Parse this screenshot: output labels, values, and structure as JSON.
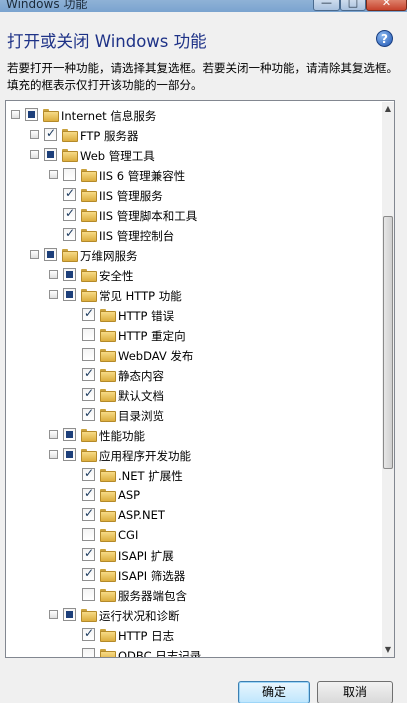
{
  "window": {
    "title": "Windows 功能",
    "min_glyph": "—",
    "max_glyph": "□",
    "close_glyph": "✕"
  },
  "heading": "打开或关闭 Windows 功能",
  "help_glyph": "?",
  "description": "若要打开一种功能，请选择其复选框。若要关闭一种功能，请清除其复选框。填充的框表示仅打开该功能的一部分。",
  "tree": [
    {
      "label": "Internet 信息服务",
      "level": 0,
      "expander": "⊟",
      "state": "partial"
    },
    {
      "label": "FTP 服务器",
      "level": 1,
      "expander": "⊞",
      "state": "checked"
    },
    {
      "label": "Web 管理工具",
      "level": 1,
      "expander": "⊟",
      "state": "partial"
    },
    {
      "label": "IIS 6 管理兼容性",
      "level": 2,
      "expander": "⊞",
      "state": "unchecked"
    },
    {
      "label": "IIS 管理服务",
      "level": 2,
      "expander": "",
      "state": "checked"
    },
    {
      "label": "IIS 管理脚本和工具",
      "level": 2,
      "expander": "",
      "state": "checked"
    },
    {
      "label": "IIS 管理控制台",
      "level": 2,
      "expander": "",
      "state": "checked"
    },
    {
      "label": "万维网服务",
      "level": 1,
      "expander": "⊟",
      "state": "partial"
    },
    {
      "label": "安全性",
      "level": 2,
      "expander": "⊞",
      "state": "partial"
    },
    {
      "label": "常见 HTTP 功能",
      "level": 2,
      "expander": "⊟",
      "state": "partial"
    },
    {
      "label": "HTTP 错误",
      "level": 3,
      "expander": "",
      "state": "checked"
    },
    {
      "label": "HTTP 重定向",
      "level": 3,
      "expander": "",
      "state": "unchecked"
    },
    {
      "label": "WebDAV 发布",
      "level": 3,
      "expander": "",
      "state": "unchecked"
    },
    {
      "label": "静态内容",
      "level": 3,
      "expander": "",
      "state": "checked"
    },
    {
      "label": "默认文档",
      "level": 3,
      "expander": "",
      "state": "checked"
    },
    {
      "label": "目录浏览",
      "level": 3,
      "expander": "",
      "state": "checked"
    },
    {
      "label": "性能功能",
      "level": 2,
      "expander": "⊞",
      "state": "partial"
    },
    {
      "label": "应用程序开发功能",
      "level": 2,
      "expander": "⊟",
      "state": "partial"
    },
    {
      "label": ".NET 扩展性",
      "level": 3,
      "expander": "",
      "state": "checked"
    },
    {
      "label": "ASP",
      "level": 3,
      "expander": "",
      "state": "checked"
    },
    {
      "label": "ASP.NET",
      "level": 3,
      "expander": "",
      "state": "checked"
    },
    {
      "label": "CGI",
      "level": 3,
      "expander": "",
      "state": "unchecked"
    },
    {
      "label": "ISAPI 扩展",
      "level": 3,
      "expander": "",
      "state": "checked"
    },
    {
      "label": "ISAPI 筛选器",
      "level": 3,
      "expander": "",
      "state": "checked"
    },
    {
      "label": "服务器端包含",
      "level": 3,
      "expander": "",
      "state": "unchecked"
    },
    {
      "label": "运行状况和诊断",
      "level": 2,
      "expander": "⊟",
      "state": "partial"
    },
    {
      "label": "HTTP 日志",
      "level": 3,
      "expander": "",
      "state": "checked"
    },
    {
      "label": "ODBC 日志记录",
      "level": 3,
      "expander": "",
      "state": "unchecked"
    }
  ],
  "scrollbar": {
    "up_glyph": "▲",
    "down_glyph": "▼",
    "position_fraction": 0.19,
    "visible_fraction": 0.48
  },
  "buttons": {
    "ok": "确定",
    "cancel": "取消"
  },
  "colors": {
    "heading": "#1e3287",
    "checkbox_fill": "#1d3f7a"
  }
}
